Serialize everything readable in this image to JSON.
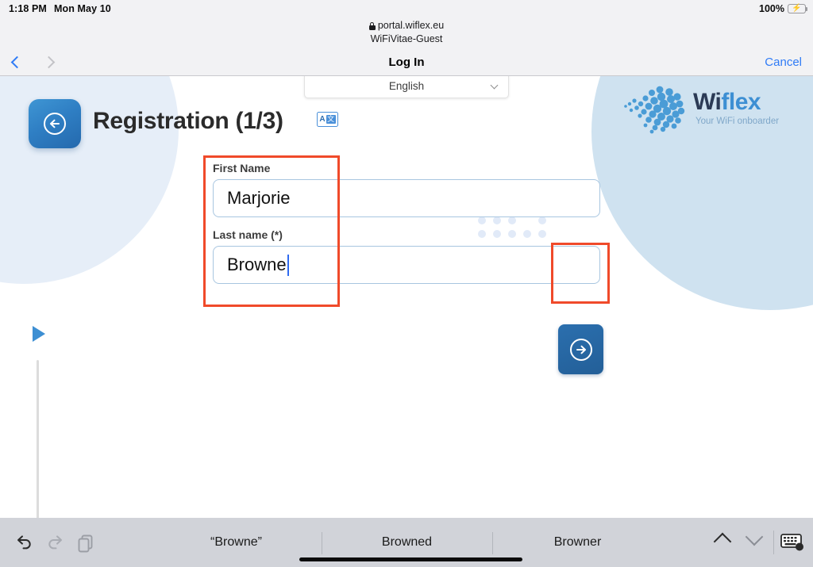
{
  "status_bar": {
    "time": "1:18 PM",
    "date": "Mon May 10",
    "battery_percent": "100%",
    "battery_icon": "battery-charging-icon",
    "bolt_glyph": "⚡"
  },
  "safari_bar": {
    "lock_icon": "lock-icon",
    "url": "portal.wiflex.eu",
    "ssid": "WiFiVitae-Guest",
    "title": "Log In",
    "cancel_label": "Cancel",
    "back_icon": "chevron-left-icon",
    "forward_icon": "chevron-right-icon"
  },
  "page": {
    "language_select": {
      "value": "English",
      "chevron_icon": "chevron-down-icon"
    },
    "header": {
      "back_icon": "arrow-left-circle-icon",
      "title": "Registration  (1/3)",
      "translate_icon": "translate-icon",
      "translate_letter": "A",
      "translate_glyph": "文"
    },
    "logo": {
      "name_first": "Wi",
      "name_second": "flex",
      "tagline": "Your WiFi onboarder",
      "mark_icon": "wiflex-sphere-icon"
    },
    "form": {
      "first_name": {
        "label": "First Name",
        "value": "Marjorie",
        "placeholder": ""
      },
      "last_name": {
        "label": "Last name (*)",
        "value": "Browne",
        "placeholder": ""
      },
      "submit_icon": "arrow-right-circle-icon"
    },
    "decor": {
      "play_icon": "play-triangle-icon",
      "dot_grid_icon": "dot-grid-icon"
    }
  },
  "annotations": {
    "color": "#f04a2a",
    "boxes": [
      {
        "name": "name-fields-highlight"
      },
      {
        "name": "submit-button-highlight"
      }
    ]
  },
  "keyboard_bar": {
    "undo_icon": "undo-icon",
    "redo_icon": "redo-icon",
    "paste_icon": "paste-icon",
    "predictions": [
      "“Browne”",
      "Browned",
      "Browner"
    ],
    "up_icon": "chevron-up-icon",
    "down_icon": "chevron-down-icon",
    "dismiss_icon": "keyboard-dismiss-icon"
  }
}
